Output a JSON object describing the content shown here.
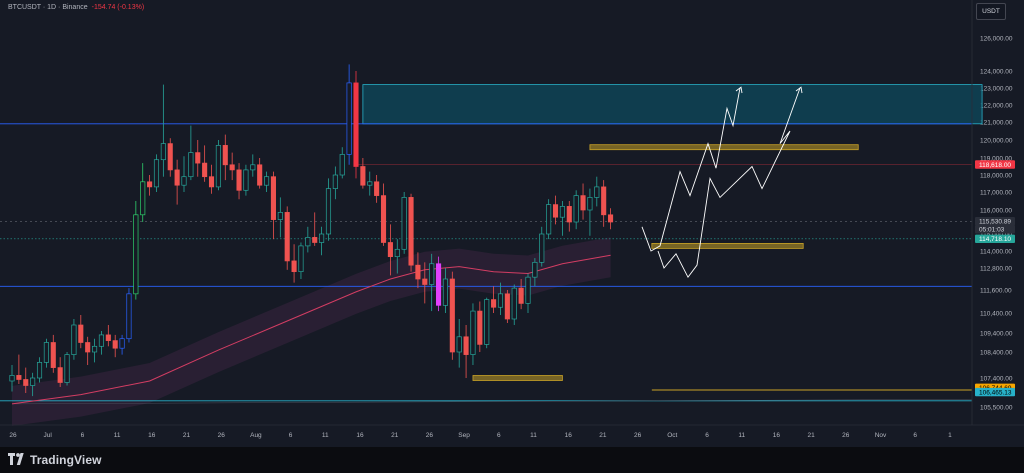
{
  "header": {
    "symbol": "BTCUSDT",
    "timeframe": "1D",
    "exchange": "Binance",
    "title": "BTCUSDT · 1D · Binance",
    "change": "-154.74 (-0.13%)"
  },
  "currency_button": "USDT",
  "branding": {
    "name": "TradingView",
    "icon": "tradingview-logo-icon"
  },
  "colors": {
    "background": "#161a25",
    "bull": "#26a69a",
    "bear": "#ef5350",
    "bull_strong": "#2ed06b",
    "bear_strong": "#f23645",
    "blue_volume_candle": "#2962ff",
    "magenta_candle": "#e040fb",
    "zone_fill": "#0e4a5c",
    "zone_border": "#27b1c9",
    "level_blue": "#2962ff",
    "gold": "#c9a227",
    "moving_average": "#d33d63",
    "cloud": "#3a2440",
    "current_price": "#26a69a",
    "price_118618": "#f23645",
    "price_106744": "#f7a600",
    "price_106465": "#27b1c9"
  },
  "chart_data": {
    "type": "candlestick",
    "symbol": "BTCUSDT",
    "interval": "1D",
    "currency": "USDT",
    "y_axis_ticks": [
      126000,
      124000,
      123000,
      122000,
      121000,
      120000,
      119000,
      118000,
      117000,
      116000,
      115000,
      114000,
      112800,
      111600,
      110400,
      109400,
      108400,
      107400,
      106400,
      105500
    ],
    "y_axis_labels": [
      "126,000.00",
      "124,000.00",
      "123,000.00",
      "122,000.00",
      "121,000.00",
      "120,000.00",
      "119,000.00",
      "118,000.00",
      "117,000.00",
      "116,000.00",
      "115,000.00",
      "114,000.00",
      "112,800.00",
      "111,600.00",
      "110,400.00",
      "109,400.00",
      "108,400.00",
      "107,400.00",
      "106,400.00",
      "105,500.00"
    ],
    "x_axis_labels": [
      "26",
      "Jul",
      "6",
      "11",
      "16",
      "21",
      "26",
      "Aug",
      "6",
      "11",
      "16",
      "21",
      "26",
      "Sep",
      "6",
      "11",
      "16",
      "21",
      "26",
      "Oct",
      "6",
      "11",
      "16",
      "21",
      "26",
      "Nov",
      "6",
      "1"
    ],
    "start_date": "2025-06-26",
    "price_labels": [
      {
        "value": 118618.0,
        "label": "118,618.00",
        "kind": "level"
      },
      {
        "value": 115530.89,
        "label": "115,530.89",
        "kind": "last"
      },
      {
        "value": 115000,
        "label": "05:01:03",
        "kind": "countdown"
      },
      {
        "value": 114718.1,
        "label": "114,718.10",
        "kind": "level"
      },
      {
        "value": 106744.69,
        "label": "106,744.69",
        "kind": "level"
      },
      {
        "value": 106465.13,
        "label": "106,465.13",
        "kind": "level"
      }
    ],
    "candles": [
      [
        107200,
        107900,
        106500,
        107500
      ],
      [
        107500,
        108300,
        107000,
        107300
      ],
      [
        107300,
        107800,
        106400,
        106900
      ],
      [
        106900,
        107600,
        106200,
        107400
      ],
      [
        107400,
        108200,
        107100,
        108000
      ],
      [
        108000,
        109100,
        107800,
        108900
      ],
      [
        108900,
        109300,
        107600,
        107800
      ],
      [
        107800,
        108200,
        106800,
        107100
      ],
      [
        107100,
        108400,
        106900,
        108300
      ],
      [
        108300,
        110100,
        108100,
        109800
      ],
      [
        109800,
        110300,
        108600,
        108900
      ],
      [
        108900,
        109200,
        107900,
        108400
      ],
      [
        108400,
        109100,
        108000,
        108700
      ],
      [
        108700,
        109500,
        108300,
        109300
      ],
      [
        109300,
        109800,
        108700,
        109000
      ],
      [
        109000,
        109300,
        108200,
        108600
      ],
      [
        108600,
        109300,
        108300,
        109100
      ],
      [
        109100,
        111700,
        108900,
        111400
      ],
      [
        111400,
        116500,
        111100,
        115800
      ],
      [
        115800,
        118700,
        115500,
        117600
      ],
      [
        117600,
        118000,
        116800,
        117300
      ],
      [
        117300,
        119200,
        117000,
        118900
      ],
      [
        118900,
        123200,
        117900,
        119800
      ],
      [
        119800,
        120100,
        117900,
        118300
      ],
      [
        118300,
        118900,
        116300,
        117400
      ],
      [
        117400,
        119100,
        117000,
        117900
      ],
      [
        117900,
        120800,
        117700,
        119300
      ],
      [
        119300,
        120000,
        117900,
        118700
      ],
      [
        118700,
        119700,
        117600,
        117900
      ],
      [
        117900,
        118600,
        116900,
        117300
      ],
      [
        117300,
        120000,
        117100,
        119700
      ],
      [
        119700,
        120300,
        117700,
        118600
      ],
      [
        118600,
        119300,
        117700,
        118300
      ],
      [
        118300,
        118700,
        116600,
        117100
      ],
      [
        117100,
        118600,
        116800,
        118300
      ],
      [
        118300,
        119200,
        117900,
        118600
      ],
      [
        118600,
        119000,
        117200,
        117400
      ],
      [
        117400,
        118200,
        117000,
        117900
      ],
      [
        117900,
        118200,
        114700,
        115600
      ],
      [
        115600,
        116700,
        114800,
        115900
      ],
      [
        115900,
        116200,
        112700,
        113300
      ],
      [
        113300,
        114400,
        112000,
        112600
      ],
      [
        112600,
        114500,
        112200,
        114300
      ],
      [
        114300,
        115300,
        113900,
        114800
      ],
      [
        114800,
        115900,
        114300,
        114500
      ],
      [
        114500,
        115300,
        113700,
        115000
      ],
      [
        115000,
        117800,
        114600,
        117200
      ],
      [
        117200,
        118500,
        116600,
        118000
      ],
      [
        118000,
        119600,
        117800,
        119200
      ],
      [
        119200,
        124400,
        118600,
        123300
      ],
      [
        123300,
        124000,
        117800,
        118500
      ],
      [
        118500,
        119000,
        117200,
        117400
      ],
      [
        117400,
        118200,
        116800,
        117600
      ],
      [
        117600,
        118000,
        116400,
        116800
      ],
      [
        116800,
        117500,
        114300,
        114500
      ],
      [
        114500,
        115400,
        112400,
        113600
      ],
      [
        113600,
        114700,
        112500,
        114100
      ],
      [
        114100,
        117000,
        113800,
        116700
      ],
      [
        116700,
        116900,
        112600,
        113000
      ],
      [
        113000,
        113900,
        111700,
        112200
      ],
      [
        112200,
        113200,
        110900,
        111900
      ],
      [
        111900,
        113800,
        110500,
        113100
      ],
      [
        113100,
        113600,
        110500,
        110800
      ],
      [
        110800,
        112800,
        110400,
        112200
      ],
      [
        112200,
        112600,
        108100,
        108400
      ],
      [
        108400,
        110100,
        107800,
        109200
      ],
      [
        109200,
        109800,
        107400,
        108300
      ],
      [
        108300,
        110900,
        107900,
        110500
      ],
      [
        110500,
        111000,
        108400,
        108800
      ],
      [
        108800,
        111200,
        108600,
        111100
      ],
      [
        111100,
        111800,
        110400,
        110700
      ],
      [
        110700,
        112000,
        110300,
        111400
      ],
      [
        111400,
        111600,
        109900,
        110100
      ],
      [
        110100,
        111900,
        109800,
        111700
      ],
      [
        111700,
        112200,
        110600,
        110900
      ],
      [
        110900,
        112500,
        110400,
        112300
      ],
      [
        112300,
        113500,
        111800,
        113200
      ],
      [
        113200,
        115300,
        112900,
        115000
      ],
      [
        115000,
        116600,
        114700,
        116300
      ],
      [
        116300,
        116800,
        115400,
        115700
      ],
      [
        115700,
        116500,
        114900,
        116200
      ],
      [
        116200,
        116500,
        115100,
        115500
      ],
      [
        115500,
        117100,
        115200,
        116800
      ],
      [
        116800,
        117500,
        115600,
        116000
      ],
      [
        116000,
        117200,
        114900,
        116700
      ],
      [
        116700,
        117900,
        116200,
        117300
      ],
      [
        117300,
        117700,
        115300,
        115800
      ],
      [
        115800,
        116100,
        115200,
        115500
      ]
    ],
    "moving_average": [
      [
        0,
        105700
      ],
      [
        10,
        106300
      ],
      [
        20,
        107200
      ],
      [
        30,
        108500
      ],
      [
        40,
        110000
      ],
      [
        50,
        111500
      ],
      [
        55,
        112200
      ],
      [
        60,
        112700
      ],
      [
        65,
        112900
      ],
      [
        70,
        112600
      ],
      [
        75,
        112500
      ],
      [
        80,
        113100
      ],
      [
        87,
        113700
      ]
    ],
    "annotations": {
      "target_zone": {
        "from_index": 51,
        "to_index": 141,
        "high": 123200,
        "low": 120900
      },
      "horizontal_lines": [
        {
          "value": 120900,
          "color": "blue"
        },
        {
          "value": 111800,
          "color": "blue"
        },
        {
          "value": 105900,
          "color": "cyan"
        }
      ],
      "gold_boxes": [
        {
          "from_index": 84,
          "to_index": 123,
          "value": 119600
        },
        {
          "from_index": 93,
          "to_index": 115,
          "value": 114300
        },
        {
          "from_index": 67,
          "to_index": 80,
          "value": 107400
        }
      ],
      "gold_line": {
        "from_index": 93,
        "to_index": 151,
        "value": 106600
      }
    }
  }
}
